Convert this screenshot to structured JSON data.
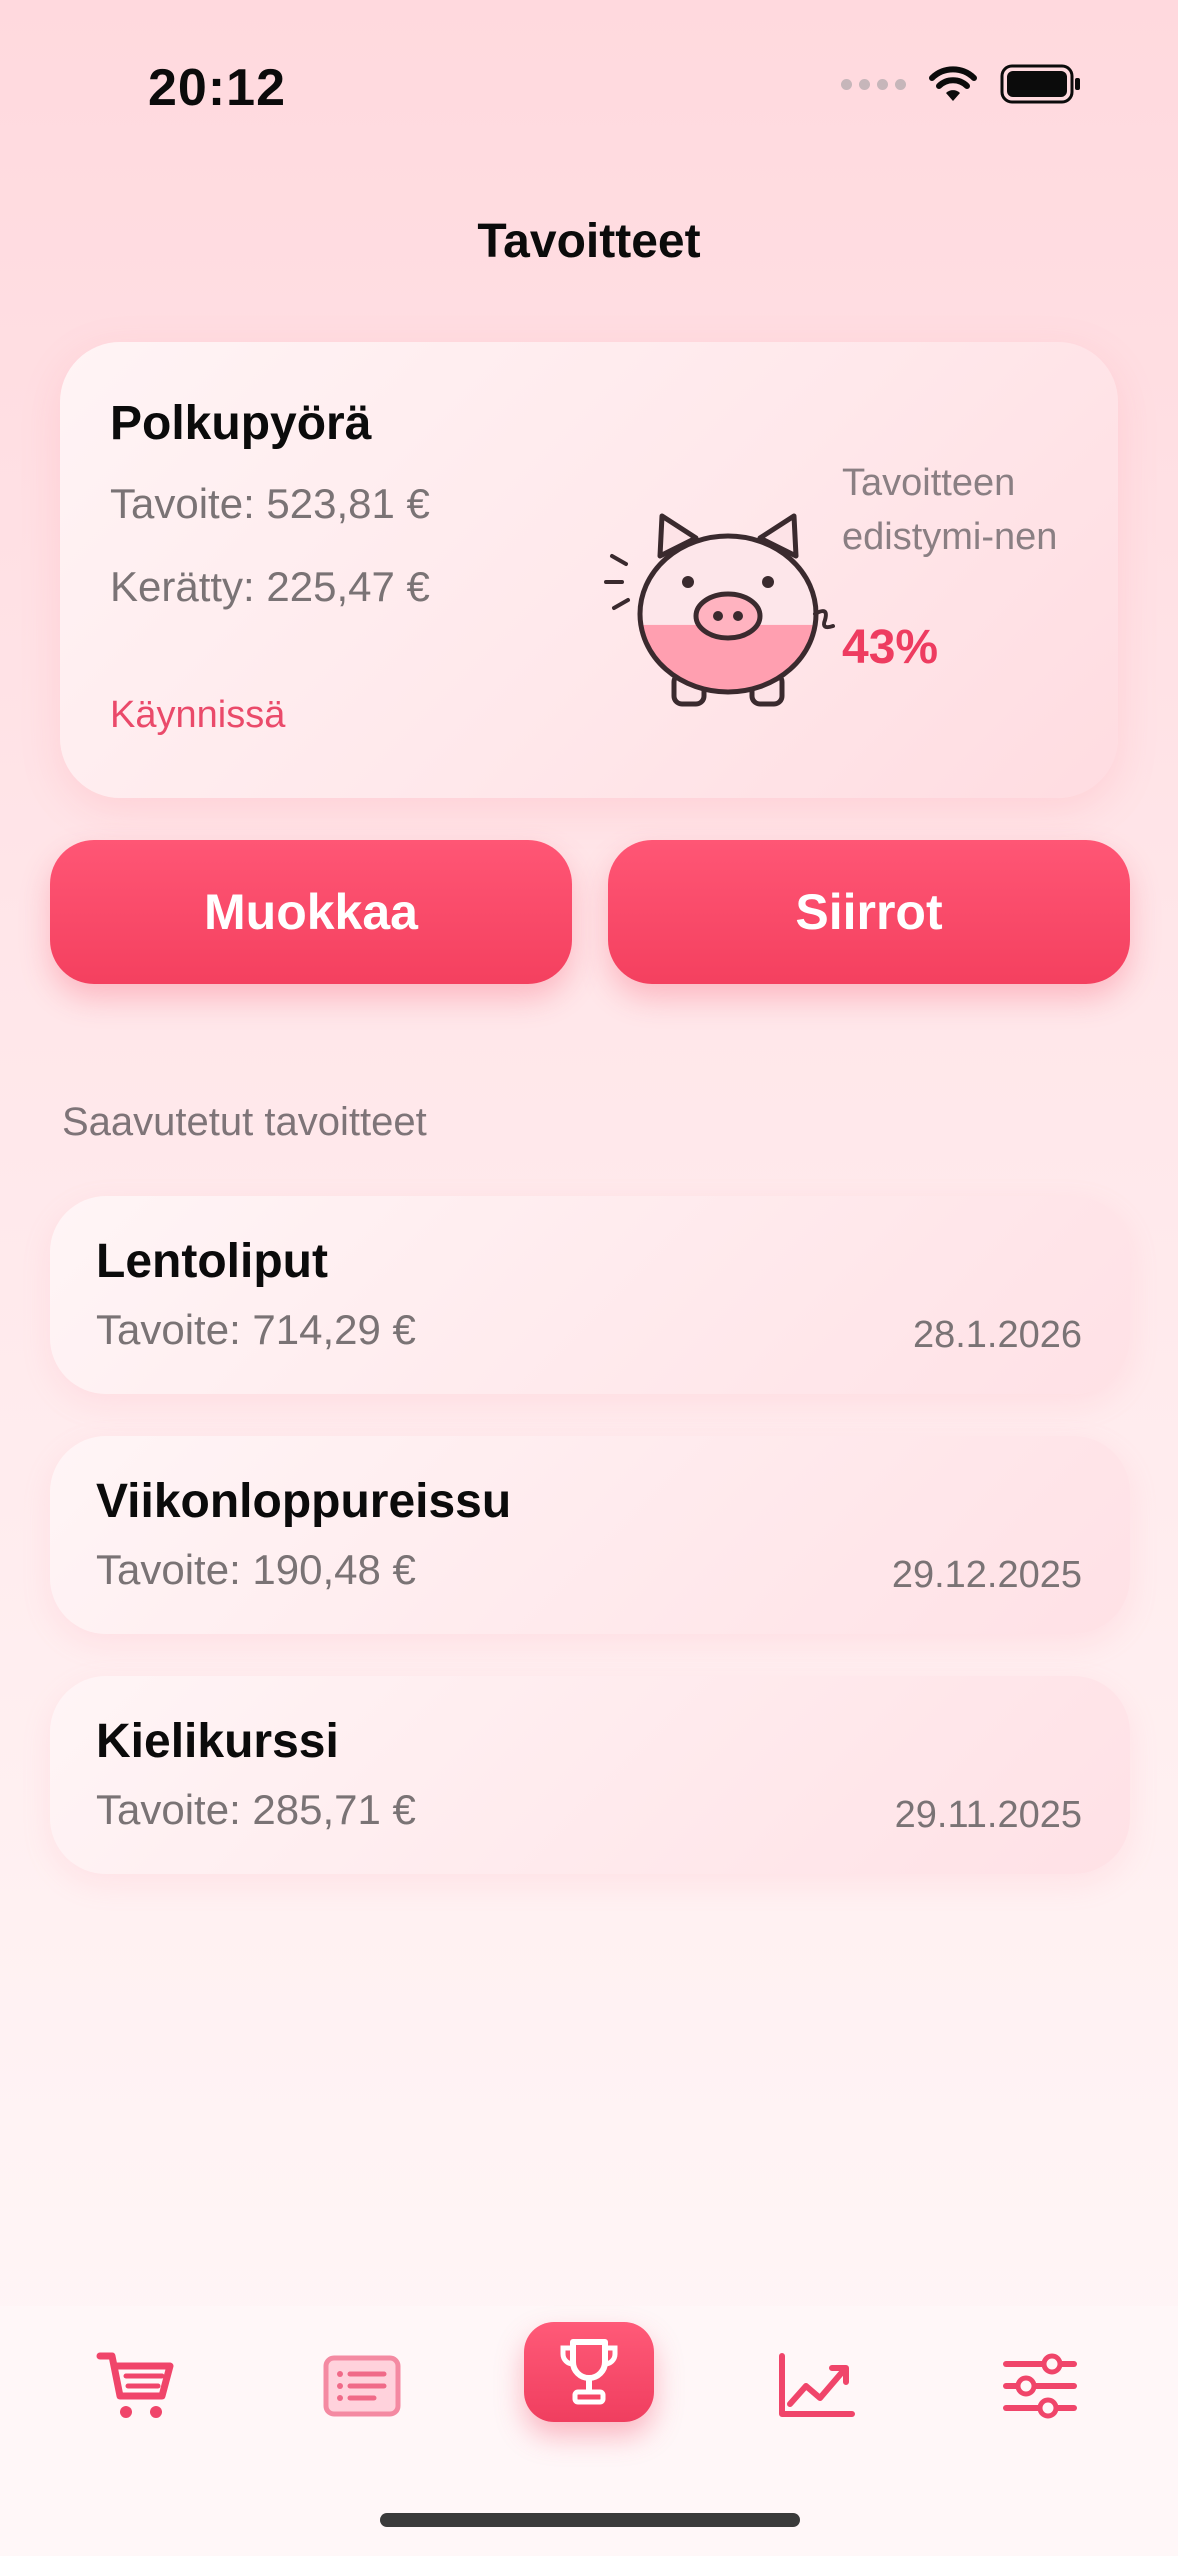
{
  "status_bar": {
    "time": "20:12"
  },
  "header": {
    "title": "Tavoitteet"
  },
  "current_goal": {
    "name": "Polkupyörä",
    "target": "Tavoite: 523,81 €",
    "collected": "Kerätty: 225,47 €",
    "status": "Käynnissä",
    "progress_label": "Tavoitteen edistymi-nen",
    "progress_value": "43%",
    "progress_fraction": 0.43
  },
  "buttons": {
    "edit": "Muokkaa",
    "transfers": "Siirrot"
  },
  "achieved": {
    "title": "Saavutetut tavoitteet",
    "items": [
      {
        "name": "Lentoliput",
        "target": "Tavoite: 714,29 €",
        "date": "28.1.2026"
      },
      {
        "name": "Viikonloppureissu",
        "target": "Tavoite: 190,48 €",
        "date": "29.12.2025"
      },
      {
        "name": "Kielikurssi",
        "target": "Tavoite: 285,71 €",
        "date": "29.11.2025"
      }
    ]
  },
  "tabs": [
    {
      "icon": "cart-icon"
    },
    {
      "icon": "list-icon"
    },
    {
      "icon": "trophy-icon",
      "active": true
    },
    {
      "icon": "chart-line-icon"
    },
    {
      "icon": "sliders-icon"
    }
  ],
  "colors": {
    "accent": "#F4405F",
    "status": "#EA4A6A",
    "background": "#FFE7EA"
  }
}
